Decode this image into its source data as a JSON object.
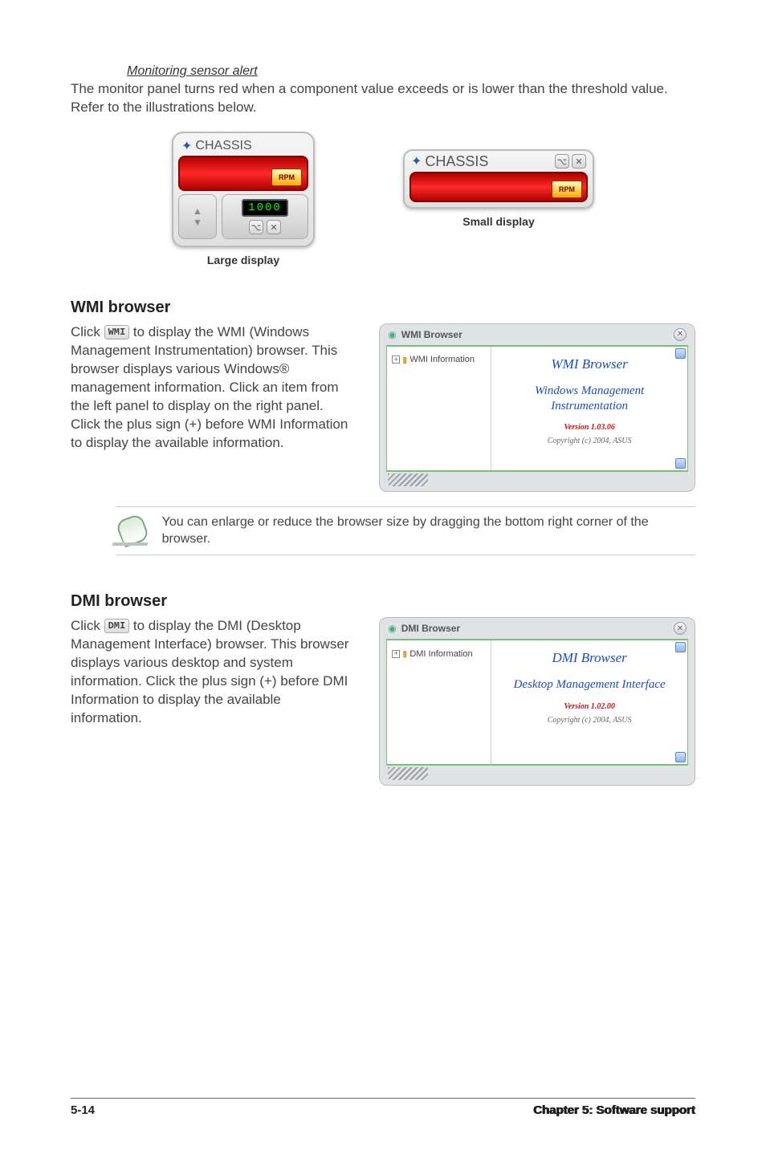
{
  "section": {
    "alert_heading": "Monitoring sensor alert"
  },
  "alert_intro": "The monitor panel turns red when a component value exceeds or is lower than the threshold value. Refer to the illustrations below.",
  "large_display": {
    "title": "CHASSIS",
    "unit": "RPM",
    "digits": "1000",
    "caption": "Large display"
  },
  "small_display": {
    "title": "CHASSIS",
    "unit": "RPM",
    "caption": "Small display"
  },
  "wmi": {
    "heading": "WMI browser",
    "pre": "Click ",
    "chip": "WMI",
    "post": " to display the WMI (Windows Management Instrumentation) browser. This browser displays various Windows® management information. Click an item from the left panel to display on the right panel. Click the plus sign (+) before WMI Information to display the available information.",
    "shot": {
      "title": "WMI Browser",
      "tree": "WMI Information",
      "content_title": "WMI Browser",
      "content_main": "Windows Management Instrumentation",
      "version": "Version 1.03.06",
      "copyright": "Copyright (c) 2004,  ASUS"
    }
  },
  "note": "You can enlarge or reduce the browser size by dragging the bottom right corner of the browser.",
  "dmi": {
    "heading": "DMI browser",
    "pre": "Click ",
    "chip": "DMI",
    "post": " to display the DMI (Desktop Management Interface) browser. This browser displays various desktop and system information. Click the plus sign (+) before DMI Information to display the available information.",
    "shot": {
      "title": "DMI Browser",
      "tree": "DMI Information",
      "content_title": "DMI Browser",
      "content_main": "Desktop Management Interface",
      "version": "Version 1.02.00",
      "copyright": "Copyright (c) 2004,  ASUS"
    }
  },
  "footer": {
    "left": "5-14",
    "right": "Chapter 5: Software support"
  }
}
